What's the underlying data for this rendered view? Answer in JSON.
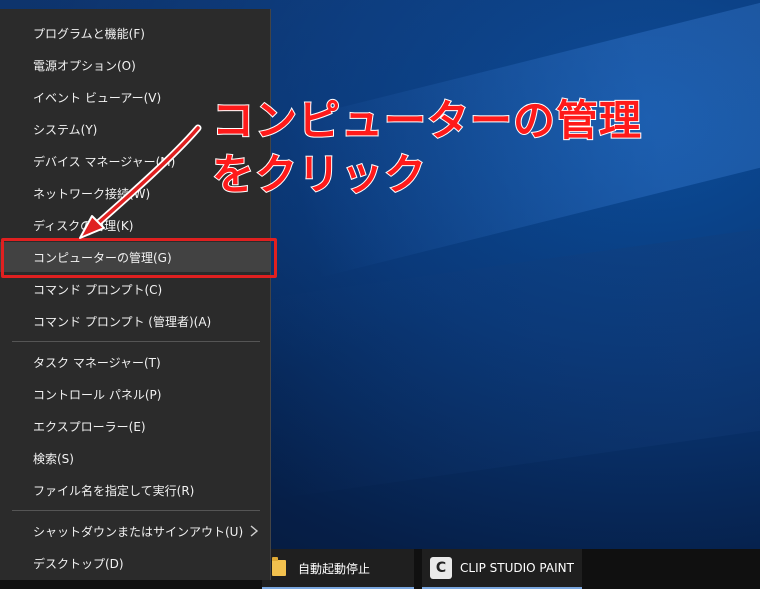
{
  "menu": {
    "items": [
      {
        "label": "プログラムと機能(F)"
      },
      {
        "label": "電源オプション(O)"
      },
      {
        "label": "イベント ビューアー(V)"
      },
      {
        "label": "システム(Y)"
      },
      {
        "label": "デバイス マネージャー(M)"
      },
      {
        "label": "ネットワーク接続(W)"
      },
      {
        "label": "ディスクの管理(K)"
      },
      {
        "label": "コンピューターの管理(G)"
      },
      {
        "label": "コマンド プロンプト(C)"
      },
      {
        "label": "コマンド プロンプト (管理者)(A)"
      },
      {
        "label": "タスク マネージャー(T)"
      },
      {
        "label": "コントロール パネル(P)"
      },
      {
        "label": "エクスプローラー(E)"
      },
      {
        "label": "検索(S)"
      },
      {
        "label": "ファイル名を指定して実行(R)"
      },
      {
        "label": "シャットダウンまたはサインアウト(U)"
      },
      {
        "label": "デスクトップ(D)"
      }
    ]
  },
  "annotation": {
    "line1": "コンピューターの管理",
    "line2": "をクリック"
  },
  "taskbar": {
    "folder_label": "自動起動停止",
    "clip_label": "CLIP STUDIO PAINT",
    "clip_icon_glyph": "C"
  },
  "icons": {
    "submenu": "chevron-right-icon",
    "folder": "folder-icon",
    "clip": "clip-studio-icon"
  },
  "colors": {
    "menu_bg": "#2b2b2b",
    "menu_highlight": "#424242",
    "annotation_red": "#e02020",
    "taskbar_accent": "#7aa7e0"
  }
}
